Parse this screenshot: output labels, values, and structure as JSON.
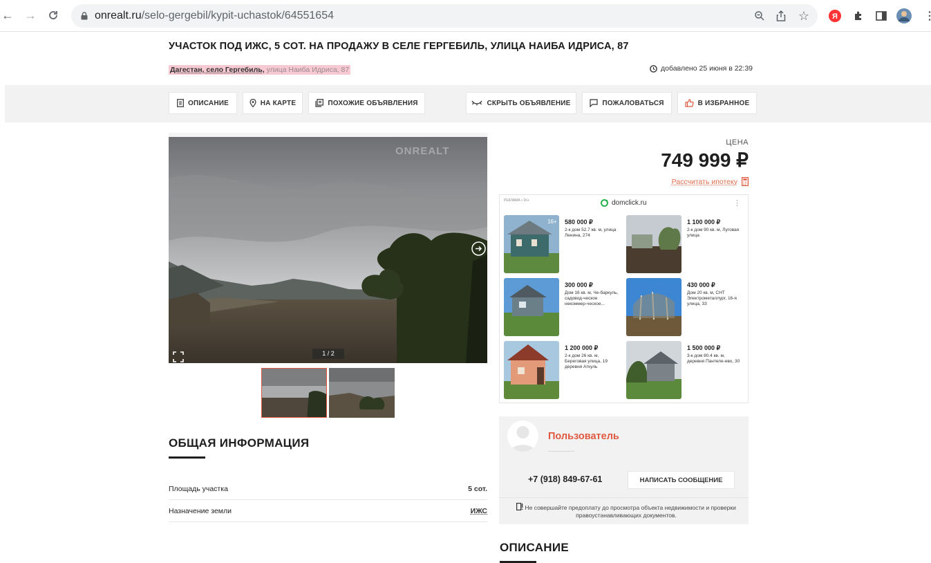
{
  "browser": {
    "url_host": "onrealt.ru",
    "url_path": "/selo-gergebil/kypit-uchastok/64551654"
  },
  "listing": {
    "title": "УЧАСТОК ПОД ИЖС, 5 СОТ. НА ПРОДАЖУ В СЕЛЕ ГЕРГЕБИЛЬ, УЛИЦА НАИБА ИДРИСА, 87",
    "location_strong": "Дагестан, село Гергебиль,",
    "location_street": "улица Наиба Идриса, 87",
    "added": "добавлено 25 июня в 22:39"
  },
  "toolbar": {
    "description": "ОПИСАНИЕ",
    "map": "НА КАРТЕ",
    "similar": "ПОХОЖИЕ ОБЪЯВЛЕНИЯ",
    "hide": "СКРЫТЬ ОБЪЯВЛЕНИЕ",
    "report": "ПОЖАЛОВАТЬСЯ",
    "favorite": "В ИЗБРАННОЕ"
  },
  "gallery": {
    "counter": "1 / 2",
    "watermark": "ONREALT"
  },
  "info": {
    "heading": "ОБЩАЯ ИНФОРМАЦИЯ",
    "rows": [
      {
        "label": "Площадь участка",
        "value": "5 сот."
      },
      {
        "label": "Назначение земли",
        "value": "ИЖС"
      }
    ]
  },
  "price": {
    "label": "ЦЕНА",
    "value": "749 999 ₽",
    "mortgage": "Рассчитать ипотеку"
  },
  "ad": {
    "label": "РЕКЛАМА • 16+",
    "brand": "domclick.ru",
    "cards": [
      {
        "price": "580 000 ₽",
        "desc": "2-к дом 52.7 кв. м, улица Ленина, 274"
      },
      {
        "price": "1 100 000 ₽",
        "desc": "2-к дом 90 кв. м, Луговая улица"
      },
      {
        "price": "300 000 ₽",
        "desc": "Дом 16 кв. м, Че-баркуль, садовод-ческое некоммер-ческое..."
      },
      {
        "price": "430 000 ₽",
        "desc": "Дом 20 кв. м, СНТ Электрометаллург, 16-я улица, 33"
      },
      {
        "price": "1 200 000 ₽",
        "desc": "2-к дом 26 кв. м, Береговая улица, 19 деревня Аткуль"
      },
      {
        "price": "1 500 000 ₽",
        "desc": "3-к дом 80.4 кв. м, деревня Пантеле-ево, 30"
      }
    ]
  },
  "seller": {
    "name": "Пользователь",
    "phone": "+7 (918) 849-67-61",
    "message_button": "НАПИСАТЬ СООБЩЕНИЕ",
    "warning": "Не совершайте предоплату до просмотра объекта недвижимости и проверки правоустанавливающих документов."
  },
  "description": {
    "heading": "ОПИСАНИЕ"
  },
  "colors": {
    "accent": "#e0583f",
    "toolbar_bg": "#f2f2f2",
    "location_highlight": "#f6c9d3"
  }
}
